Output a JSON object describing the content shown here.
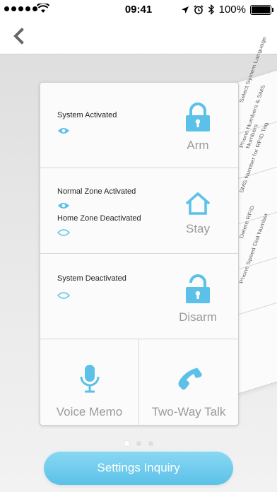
{
  "status_bar": {
    "time": "09:41",
    "battery": "100%"
  },
  "settings_preview": {
    "items": [
      "Select System Language",
      "Phone Numbers & SMS Numbers",
      "SMS Number for RFID Tag",
      "Delete RFID",
      "Phone Speed Dial Number"
    ]
  },
  "arm_panel": {
    "status": "System Activated",
    "action": "Arm"
  },
  "stay_panel": {
    "status_1": "Normal Zone Activated",
    "status_2": "Home Zone Deactivated",
    "action": "Stay"
  },
  "disarm_panel": {
    "status": "System Deactivated",
    "action": "Disarm"
  },
  "voice_memo": {
    "label": "Voice Memo"
  },
  "two_way_talk": {
    "label": "Two-Way Talk"
  },
  "pager": {
    "pages": 3,
    "current": 1
  },
  "bottom": {
    "button_label": "Settings Inquiry"
  },
  "colors": {
    "accent": "#5bc1e8",
    "icon": "#5bc1e8",
    "label_gray": "#9a9a9a"
  }
}
